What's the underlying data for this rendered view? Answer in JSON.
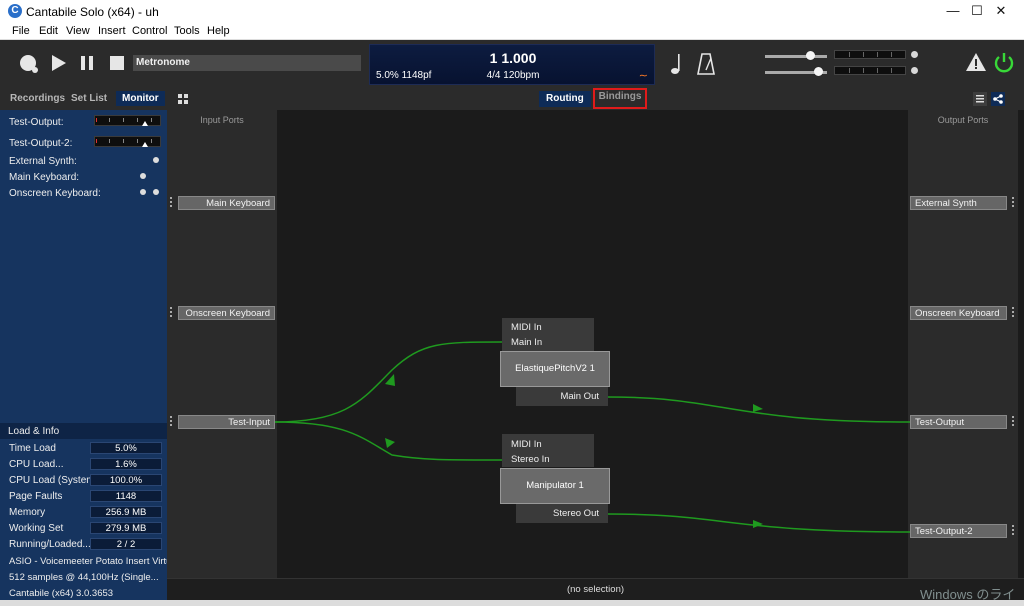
{
  "window": {
    "title": "Cantabile Solo (x64) - uh",
    "app_icon_glyph": "C"
  },
  "menu": [
    "File",
    "Edit",
    "View",
    "Insert",
    "Control",
    "Tools",
    "Help"
  ],
  "toolbar": {
    "metronome_label": "Metronome",
    "position": "1 1.000",
    "load": "5.0%  1148pf",
    "time_signature": "4/4 120bpm"
  },
  "tabs": {
    "left": [
      "Recordings",
      "Set List",
      "Monitor"
    ],
    "active_left": "Monitor",
    "center": [
      "Routing",
      "Bindings"
    ],
    "active_center": "Routing"
  },
  "monitor": {
    "rows": [
      "Test-Output:",
      "Test-Output-2:",
      "External Synth:",
      "Main Keyboard:",
      "Onscreen Keyboard:"
    ]
  },
  "load_info": {
    "header": "Load & Info",
    "rows": [
      {
        "label": "Time Load",
        "value": "5.0%"
      },
      {
        "label": "CPU Load...",
        "value": "1.6%"
      },
      {
        "label": "CPU Load (System)",
        "value": "100.0%"
      },
      {
        "label": "Page Faults",
        "value": "1148"
      },
      {
        "label": "Memory",
        "value": "256.9 MB"
      },
      {
        "label": "Working Set",
        "value": "279.9 MB"
      },
      {
        "label": "Running/Loaded...",
        "value": "2 / 2"
      }
    ],
    "lines": [
      "ASIO - Voicemeeter Potato Insert Virtu...",
      "512 samples @ 44,100Hz (Single...",
      "Cantabile (x64) 3.0.3653"
    ]
  },
  "routing": {
    "input_ports_header": "Input Ports",
    "output_ports_header": "Output Ports",
    "input_ports": [
      "Main Keyboard",
      "Onscreen Keyboard",
      "Test-Input"
    ],
    "output_ports": [
      "External Synth",
      "Onscreen Keyboard",
      "Test-Output",
      "Test-Output-2"
    ],
    "plugins": [
      {
        "name": "ElastiquePitchV2 1",
        "inputs": [
          "MIDI In",
          "Main In"
        ],
        "output": "Main Out"
      },
      {
        "name": "Manipulator 1",
        "inputs": [
          "MIDI In",
          "Stereo In"
        ],
        "output": "Stereo Out"
      }
    ],
    "wire_color": "#1f9a1f"
  },
  "status": "(no selection)",
  "watermark": "Windows のライ"
}
